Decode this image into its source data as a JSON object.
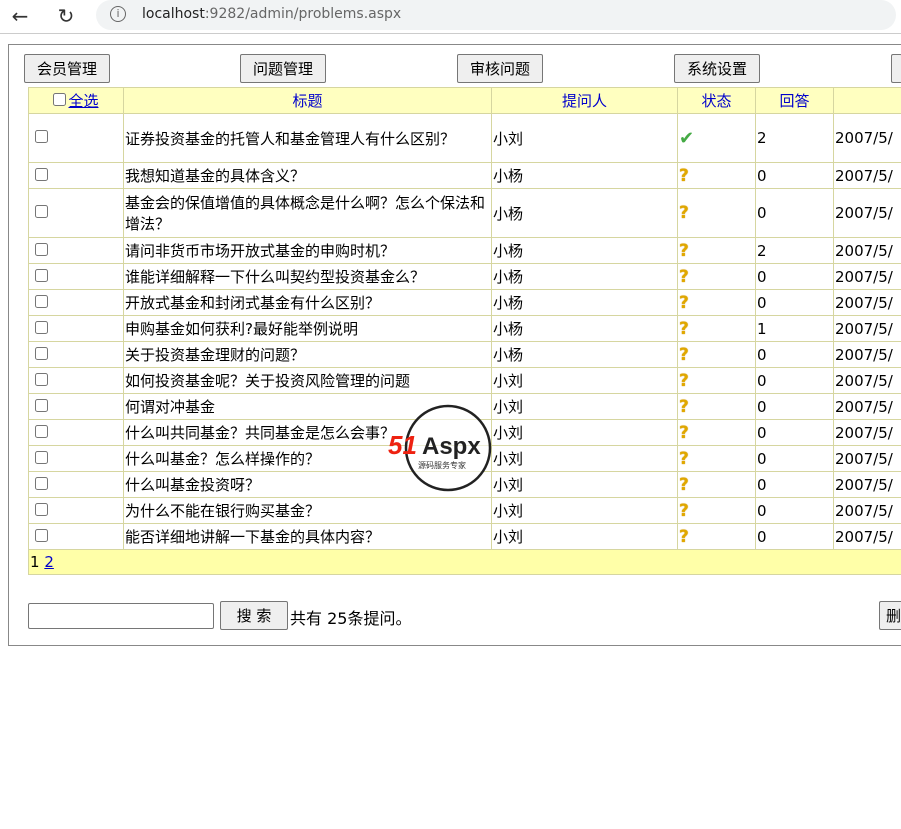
{
  "browser": {
    "url_host": "localhost",
    "url_rest": ":9282/admin/problems.aspx"
  },
  "nav": [
    "会员管理",
    "问题管理",
    "审核问题",
    "系统设置"
  ],
  "table": {
    "headers": {
      "select_all": "全选",
      "title": "标题",
      "asker": "提问人",
      "status": "状态",
      "answers": "回答"
    },
    "rows": [
      {
        "title": "证券投资基金的托管人和基金管理人有什么区别？",
        "asker": "小刘",
        "status": "answered",
        "answers": "2",
        "date": "2007/5/"
      },
      {
        "title": "我想知道基金的具体含义？",
        "asker": "小杨",
        "status": "pending",
        "answers": "0",
        "date": "2007/5/"
      },
      {
        "title": "基金会的保值增值的具体概念是什么啊？怎么个保法和增法？",
        "asker": "小杨",
        "status": "pending",
        "answers": "0",
        "date": "2007/5/"
      },
      {
        "title": "请问非货币市场开放式基金的申购时机？",
        "asker": "小杨",
        "status": "pending",
        "answers": "2",
        "date": "2007/5/"
      },
      {
        "title": "谁能详细解释一下什么叫契约型投资基金么？",
        "asker": "小杨",
        "status": "pending",
        "answers": "0",
        "date": "2007/5/"
      },
      {
        "title": "开放式基金和封闭式基金有什么区别？",
        "asker": "小杨",
        "status": "pending",
        "answers": "0",
        "date": "2007/5/"
      },
      {
        "title": "申购基金如何获利?最好能举例说明",
        "asker": "小杨",
        "status": "pending",
        "answers": "1",
        "date": "2007/5/"
      },
      {
        "title": "关于投资基金理财的问题？",
        "asker": "小杨",
        "status": "pending",
        "answers": "0",
        "date": "2007/5/"
      },
      {
        "title": "如何投资基金呢？关于投资风险管理的问题",
        "asker": "小刘",
        "status": "pending",
        "answers": "0",
        "date": "2007/5/"
      },
      {
        "title": "何谓对冲基金",
        "asker": "小刘",
        "status": "pending",
        "answers": "0",
        "date": "2007/5/"
      },
      {
        "title": "什么叫共同基金？共同基金是怎么会事？",
        "asker": "小刘",
        "status": "pending",
        "answers": "0",
        "date": "2007/5/"
      },
      {
        "title": "什么叫基金？怎么样操作的？",
        "asker": "小刘",
        "status": "pending",
        "answers": "0",
        "date": "2007/5/"
      },
      {
        "title": "什么叫基金投资呀？",
        "asker": "小刘",
        "status": "pending",
        "answers": "0",
        "date": "2007/5/"
      },
      {
        "title": "为什么不能在银行购买基金？",
        "asker": "小刘",
        "status": "pending",
        "answers": "0",
        "date": "2007/5/"
      },
      {
        "title": "能否详细地讲解一下基金的具体内容？",
        "asker": "小刘",
        "status": "pending",
        "answers": "0",
        "date": "2007/5/"
      }
    ],
    "pager": {
      "current": "1",
      "other": "2"
    }
  },
  "search": {
    "value": "",
    "button": "搜 索",
    "total": "共有 25条提问。",
    "delete_partial": "删"
  },
  "watermark": {
    "brand": "51Aspx",
    "tagline": "源码服务专家"
  }
}
